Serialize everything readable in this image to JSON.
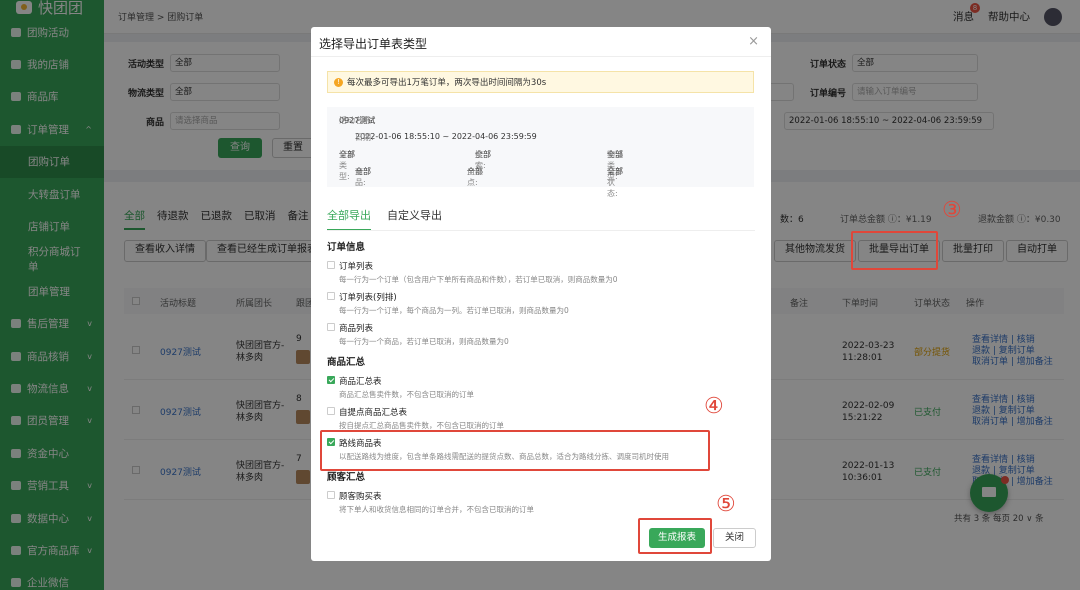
{
  "app": {
    "logo": "快团团"
  },
  "sidebar": {
    "items": [
      {
        "label": "团购活动",
        "arrow": ""
      },
      {
        "label": "我的店铺",
        "arrow": ""
      },
      {
        "label": "商品库",
        "arrow": ""
      },
      {
        "label": "订单管理",
        "arrow": "^"
      },
      {
        "label": "团购订单",
        "arrow": ""
      },
      {
        "label": "大转盘订单",
        "arrow": ""
      },
      {
        "label": "店铺订单",
        "arrow": ""
      },
      {
        "label": "积分商城订单",
        "arrow": ""
      },
      {
        "label": "团单管理",
        "arrow": ""
      },
      {
        "label": "售后管理",
        "arrow": "v"
      },
      {
        "label": "商品核销",
        "arrow": "v"
      },
      {
        "label": "物流信息",
        "arrow": "v"
      },
      {
        "label": "团员管理",
        "arrow": "v"
      },
      {
        "label": "资金中心",
        "arrow": ""
      },
      {
        "label": "营销工具",
        "arrow": "v"
      },
      {
        "label": "数据中心",
        "arrow": "v"
      },
      {
        "label": "官方商品库",
        "arrow": "v"
      },
      {
        "label": "企业微信",
        "arrow": ""
      }
    ]
  },
  "topbar": {
    "breadcrumb": "订单管理 > 团购订单",
    "messages": "消息",
    "msg_count": "8",
    "help": "帮助中心"
  },
  "filters": {
    "activity_type_label": "活动类型",
    "activity_type_value": "全部",
    "logistics_type_label": "物流类型",
    "logistics_type_value": "全部",
    "product_label": "商品",
    "product_placeholder": "请选择商品",
    "order_status_label": "订单状态",
    "order_status_value": "全部",
    "order_no_label": "订单编号",
    "order_no_placeholder": "请输入订单编号",
    "name_placeholder": "名",
    "date_range": "2022-01-06 18:55:10 ~ 2022-04-06 23:59:59",
    "query_button": "查询",
    "reset_button": "重置"
  },
  "panel": {
    "tabs": [
      "全部",
      "待退款",
      "已退款",
      "已取消",
      "备注"
    ],
    "summary_count_label": "数：6",
    "summary_total": "订单总金额 ⓘ：¥1.19",
    "summary_refund": "退款金额 ⓘ：¥0.30",
    "btn_income": "查看收入详情",
    "btn_generated": "查看已经生成订单报表",
    "btn_other_logistics": "其他物流发货",
    "btn_batch_export": "批量导出订单",
    "btn_batch_print": "批量打印",
    "btn_auto_print": "自动打单",
    "headers": {
      "title": "活动标题",
      "leader": "所属团长",
      "follow": "跟团",
      "remark": "备注",
      "time": "下单时间",
      "status": "订单状态",
      "ops": "操作"
    },
    "rows": [
      {
        "title": "0927测试",
        "leader": "快团团官方-林多肉",
        "num": "9",
        "time": "2022-03-23 11:28:01",
        "status": "部分提货",
        "ops1": "查看详情 | 核销",
        "ops2": "退款 | 复制订单",
        "ops3": "取消订单 | 增加备注"
      },
      {
        "title": "0927测试",
        "leader": "快团团官方-林多肉",
        "num": "8",
        "time": "2022-02-09 15:21:22",
        "status": "已支付",
        "ops1": "查看详情 | 核销",
        "ops2": "退款 | 复制订单",
        "ops3": "取消订单 | 增加备注"
      },
      {
        "title": "0927测试",
        "leader": "快团团官方-林多肉",
        "num": "7",
        "time": "2022-01-13 10:36:01",
        "status": "已支付",
        "ops1": "查看详情 | 核销",
        "ops2": "退款 | 复制订单",
        "ops3": "取消订单 | 增加备注"
      }
    ],
    "pagination": "共有 3 条  每页 20 ∨ 条"
  },
  "modal": {
    "title": "选择导出订单表类型",
    "close": "×",
    "alert": "每次最多可导出1万笔订单，两次导出时间间隔为30s",
    "info": {
      "name_label": "活动名称:",
      "name": "0927测试",
      "date_label": "日期:",
      "date": "2022-01-06 18:55:10 ~ 2022-04-06 23:59:59",
      "order_type_label": "订单类型:",
      "order_type": "全部",
      "search_label": "搜索:",
      "search": "全部",
      "logistics_label": "物流类型:",
      "logistics": "全部",
      "product_label": "商品:",
      "product": "全部",
      "pickup_label": "自提点:",
      "pickup": "全部",
      "status_label": "订单状态:",
      "status": "全部"
    },
    "tabs": [
      "全部导出",
      "自定义导出"
    ],
    "sections": [
      {
        "title": "订单信息",
        "options": [
          {
            "name": "订单列表",
            "desc": "每一行为一个订单（包含用户下单所有商品和件数），若订单已取消，则商品数量为0",
            "checked": false
          },
          {
            "name": "订单列表(列排)",
            "desc": "每一行为一个订单，每个商品为一列。若订单已取消，则商品数量为0",
            "checked": false
          },
          {
            "name": "商品列表",
            "desc": "每一行为一个商品，若订单已取消，则商品数量为0",
            "checked": false
          }
        ]
      },
      {
        "title": "商品汇总",
        "options": [
          {
            "name": "商品汇总表",
            "desc": "商品汇总售卖件数，不包含已取消的订单",
            "checked": true
          },
          {
            "name": "自提点商品汇总表",
            "desc": "按自提点汇总商品售卖件数，不包含已取消的订单",
            "checked": false
          },
          {
            "name": "路线商品表",
            "desc": "以配送路线为维度，包含单条路线需配送的提货点数、商品总数，适合为路线分拣、调度司机时使用",
            "checked": true
          }
        ]
      },
      {
        "title": "顾客汇总",
        "options": [
          {
            "name": "顾客购买表",
            "desc": "将下单人和收货信息相同的订单合并，不包含已取消的订单",
            "checked": false
          }
        ]
      }
    ],
    "generate_button": "生成报表",
    "close_button": "关闭"
  },
  "annotations": {
    "step3": "③",
    "step4": "④",
    "step5": "⑤"
  }
}
